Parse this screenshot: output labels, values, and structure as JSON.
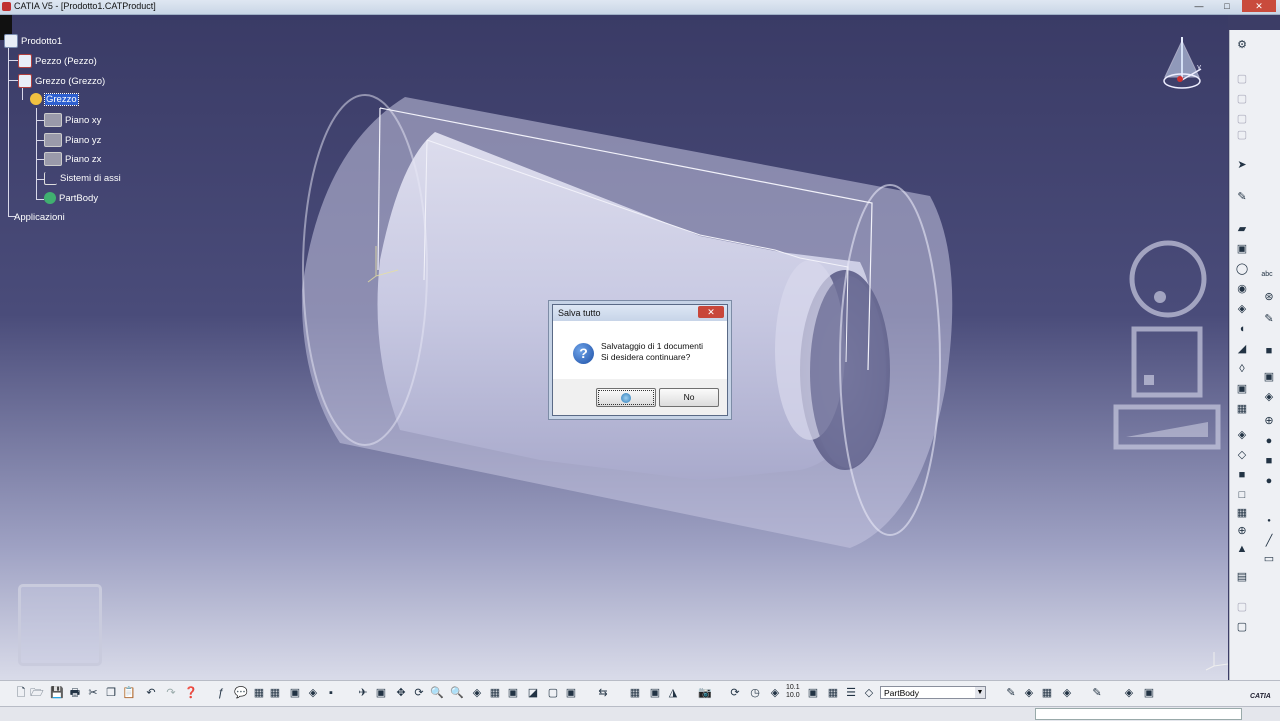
{
  "window": {
    "title": "CATIA V5 - [Prodotto1.CATProduct]"
  },
  "tree": {
    "root": "Prodotto1",
    "items": [
      {
        "label": "Pezzo (Pezzo)"
      },
      {
        "label": "Grezzo (Grezzo)"
      },
      {
        "label": "Grezzo"
      },
      {
        "label": "Piano xy"
      },
      {
        "label": "Piano yz"
      },
      {
        "label": "Piano zx"
      },
      {
        "label": "Sistemi di assi"
      },
      {
        "label": "PartBody"
      },
      {
        "label": "Applicazioni"
      }
    ]
  },
  "dialog": {
    "title": "Salva tutto",
    "line1": "Salvataggio di 1 documenti",
    "line2": "Si desidera continuare?",
    "no_label": "No"
  },
  "toolbar": {
    "body_select_value": "PartBody",
    "zoom_value_top": "10.1",
    "zoom_value_bottom": "10.0"
  },
  "brand": {
    "logo_text": "CATIA"
  },
  "colors": {
    "selection": "#2d5fd0",
    "viewport_top": "#3a3b66",
    "viewport_bottom": "#d9dbe9"
  }
}
